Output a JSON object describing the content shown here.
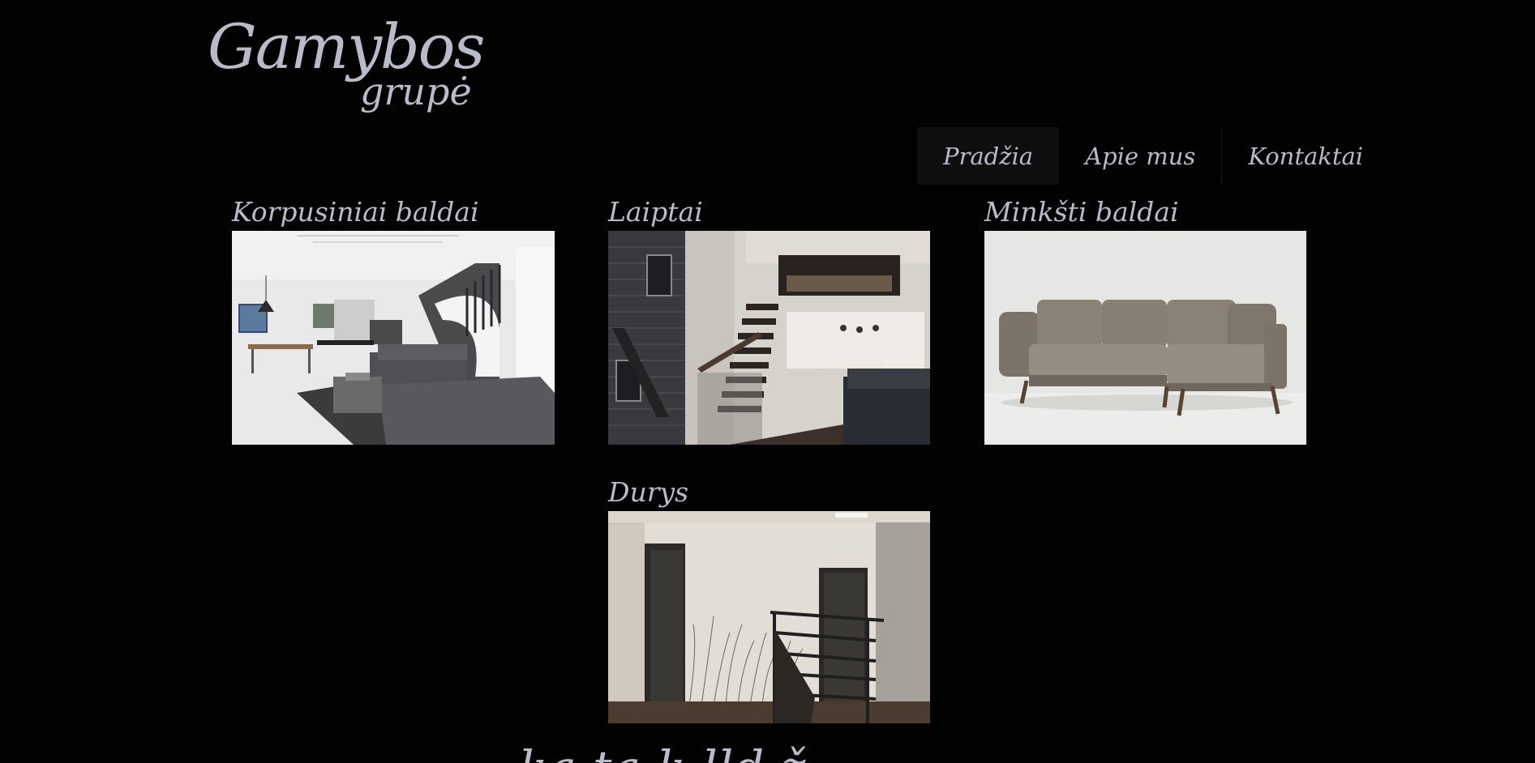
{
  "logo": {
    "line1": "Gamybos",
    "line2": "grupė"
  },
  "nav": {
    "items": [
      {
        "label": "Pradžia",
        "active": true
      },
      {
        "label": "Apie mus",
        "active": false
      },
      {
        "label": "Kontaktai",
        "active": false
      }
    ]
  },
  "categories": [
    {
      "title": "Korpusiniai baldai",
      "image": "living-room-photo"
    },
    {
      "title": "Laiptai",
      "image": "stairs-photo"
    },
    {
      "title": "Minkšti baldai",
      "image": "sofa-photo"
    },
    {
      "title": "Durys",
      "image": "doors-photo"
    }
  ],
  "footer": {
    "partial_heading": "ka   ta   k    lld  ž"
  }
}
